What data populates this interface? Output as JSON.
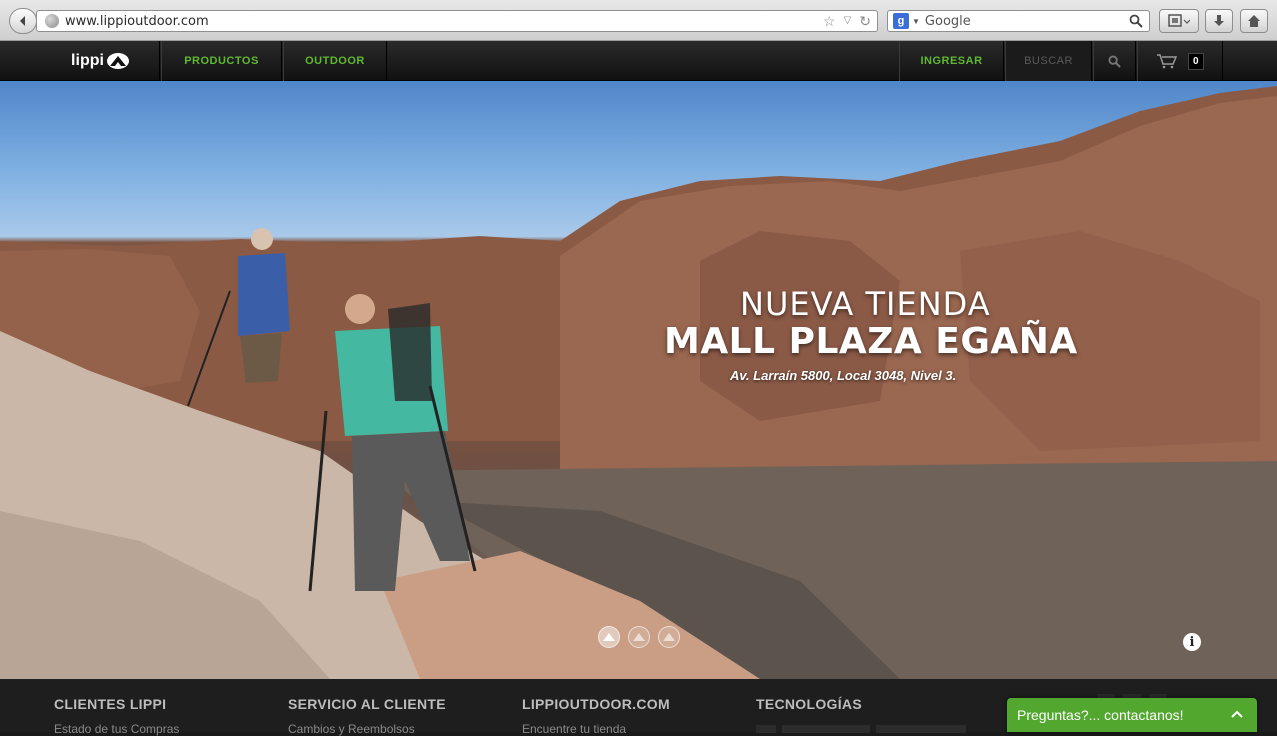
{
  "browser": {
    "url": "www.lippioutdoor.com",
    "search_placeholder": "Google",
    "search_engine_badge": "g"
  },
  "nav": {
    "logo_text": "lippi",
    "items": [
      {
        "label": "PRODUCTOS"
      },
      {
        "label": "OUTDOOR"
      }
    ],
    "login_label": "INGRESAR",
    "search_label": "BUSCAR",
    "cart_count": "0"
  },
  "hero": {
    "line1": "NUEVA TIENDA",
    "line2": "MALL PLAZA EGAÑA",
    "line3": "Av. Larraín 5800, Local  3048, Nivel 3.",
    "info_glyph": "i",
    "slide_count": 3,
    "active_slide": 1
  },
  "footer": {
    "columns": [
      {
        "heading": "CLIENTES LIPPI",
        "link": "Estado de tus Compras"
      },
      {
        "heading": "SERVICIO AL CLIENTE",
        "link": "Cambios y Reembolsos"
      },
      {
        "heading": "LIPPIOUTDOOR.COM",
        "link": "Encuentre tu tienda"
      },
      {
        "heading": "TECNOLOGÍAS",
        "link": ""
      }
    ]
  },
  "chat": {
    "label": "Preguntas?... contactanos!",
    "chevron": "^"
  },
  "colors": {
    "accent_green": "#5fb832",
    "chat_green": "#52a82e"
  }
}
